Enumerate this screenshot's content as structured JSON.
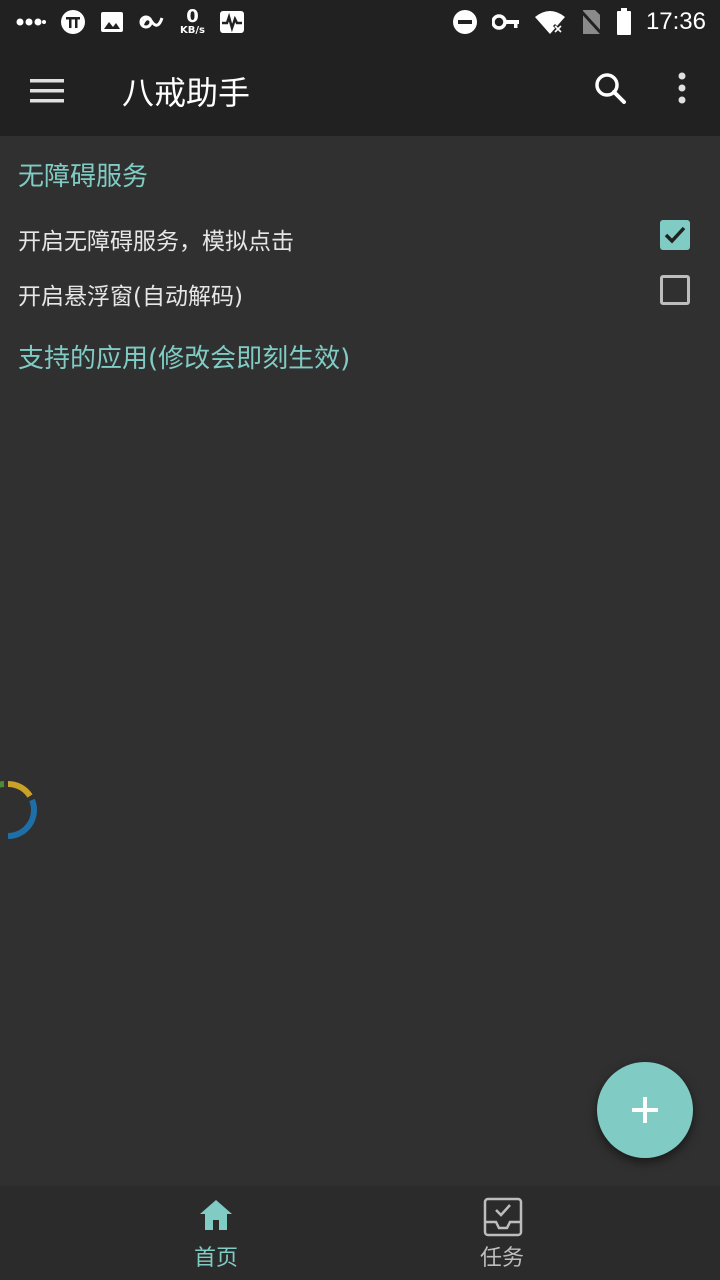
{
  "status_bar": {
    "net_speed_value": "0",
    "net_speed_unit": "KB/s",
    "time": "17:36"
  },
  "app_bar": {
    "title": "八戒助手"
  },
  "sections": {
    "accessibility_title": "无障碍服务",
    "supported_apps_title": "支持的应用(修改会即刻生效)"
  },
  "preferences": [
    {
      "label": "开启无障碍服务，模拟点击",
      "checked": true
    },
    {
      "label": "开启悬浮窗(自动解码)",
      "checked": false
    }
  ],
  "bottom_nav": {
    "home_label": "首页",
    "task_label": "任务"
  },
  "colors": {
    "accent": "#80cbc4",
    "background": "#303030",
    "bar": "#212121"
  }
}
